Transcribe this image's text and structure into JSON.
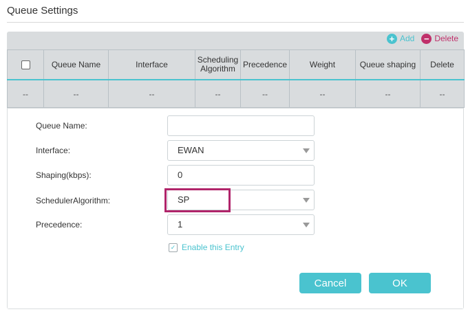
{
  "page": {
    "title": "Queue Settings"
  },
  "toolbar": {
    "add_label": "Add",
    "add_icon": "plus-circle-icon",
    "delete_label": "Delete",
    "delete_icon": "minus-circle-icon",
    "add_color": "#4ac3cf",
    "delete_color": "#c0306a"
  },
  "table": {
    "headers": [
      "Queue Name",
      "Interface",
      "Scheduling Algorithm",
      "Precedence",
      "Weight",
      "Queue shaping",
      "Delete"
    ],
    "row": [
      "--",
      "--",
      "--",
      "--",
      "--",
      "--",
      "--",
      "--"
    ]
  },
  "form": {
    "queue_name": {
      "label": "Queue Name:",
      "value": ""
    },
    "interface": {
      "label": "Interface:",
      "value": "EWAN"
    },
    "shaping": {
      "label": "Shaping(kbps):",
      "value": "0"
    },
    "scheduler": {
      "label": "SchedulerAlgorithm:",
      "value": "SP"
    },
    "precedence": {
      "label": "Precedence:",
      "value": "1"
    },
    "enable": {
      "label": "Enable this Entry",
      "checked": true
    },
    "cancel_label": "Cancel",
    "ok_label": "OK"
  },
  "colors": {
    "accent": "#4ac3cf",
    "highlight": "#b0246a"
  }
}
